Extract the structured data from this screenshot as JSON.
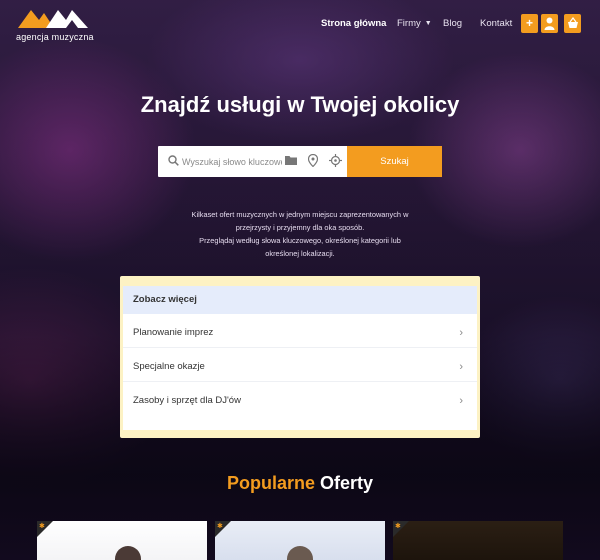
{
  "brand": {
    "name": "agencja muzyczna",
    "accent": "#f39c1f"
  },
  "nav": {
    "home": "Strona główna",
    "firms": "Firmy",
    "blog": "Blog",
    "contact": "Kontakt"
  },
  "header_icons": [
    "plus-icon",
    "user-icon",
    "basket-icon"
  ],
  "hero": {
    "headline": "Znajdź usługi w Twojej okolicy",
    "search": {
      "placeholder": "Wyszukaj słowo kluczowe",
      "button": "Szukaj"
    },
    "description_lines": [
      "Kilkaset ofert muzycznych w jednym miejscu zaprezentowanych w",
      "przejrzysty i przyjemny dla oka sposób.",
      "Przeglądaj według słowa kluczowego, określonej kategorii lub",
      "określonej lokalizacji."
    ]
  },
  "dropdown": {
    "header": "Zobacz więcej",
    "items": [
      {
        "label": "Planowanie imprez"
      },
      {
        "label": "Specjalne okazje"
      },
      {
        "label": "Zasoby i sprzęt dla DJ'ów"
      }
    ]
  },
  "popular": {
    "highlight": "Popularne",
    "rest": "Oferty"
  }
}
